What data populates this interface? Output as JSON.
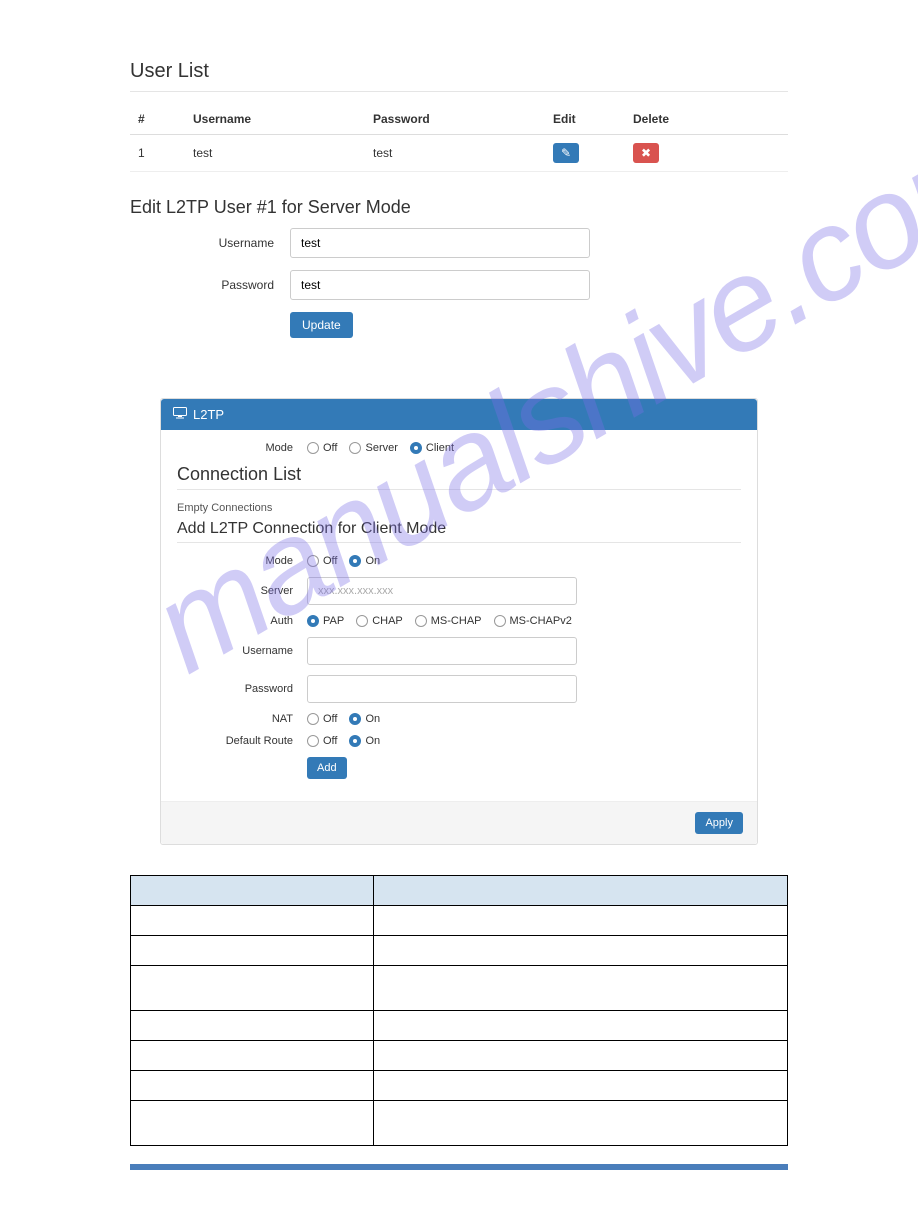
{
  "userList": {
    "title": "User List",
    "columns": {
      "idx": "#",
      "username": "Username",
      "password": "Password",
      "edit": "Edit",
      "delete": "Delete"
    },
    "rows": [
      {
        "idx": "1",
        "username": "test",
        "password": "test"
      }
    ]
  },
  "editForm": {
    "title": "Edit L2TP User #1 for Server Mode",
    "labels": {
      "username": "Username",
      "password": "Password"
    },
    "values": {
      "username": "test",
      "password": "test"
    },
    "updateLabel": "Update"
  },
  "panel": {
    "title": "L2TP",
    "modeLabel": "Mode",
    "modeOptions": {
      "off": "Off",
      "server": "Server",
      "client": "Client"
    },
    "modeSelected": "client",
    "connList": {
      "title": "Connection List",
      "empty": "Empty Connections"
    },
    "addTitle": "Add L2TP Connection for Client Mode",
    "form": {
      "mode": {
        "label": "Mode",
        "options": {
          "off": "Off",
          "on": "On"
        },
        "selected": "on"
      },
      "server": {
        "label": "Server",
        "placeholder": "xxx.xxx.xxx.xxx",
        "value": ""
      },
      "auth": {
        "label": "Auth",
        "options": {
          "pap": "PAP",
          "chap": "CHAP",
          "mschap": "MS-CHAP",
          "mschapv2": "MS-CHAPv2"
        },
        "selected": "pap"
      },
      "username": {
        "label": "Username",
        "value": ""
      },
      "password": {
        "label": "Password",
        "value": ""
      },
      "nat": {
        "label": "NAT",
        "options": {
          "off": "Off",
          "on": "On"
        },
        "selected": "on"
      },
      "route": {
        "label": "Default Route",
        "options": {
          "off": "Off",
          "on": "On"
        },
        "selected": "on"
      },
      "addLabel": "Add"
    },
    "applyLabel": "Apply"
  },
  "descTable": {
    "rows": 8
  },
  "watermark": "manualshive.com"
}
